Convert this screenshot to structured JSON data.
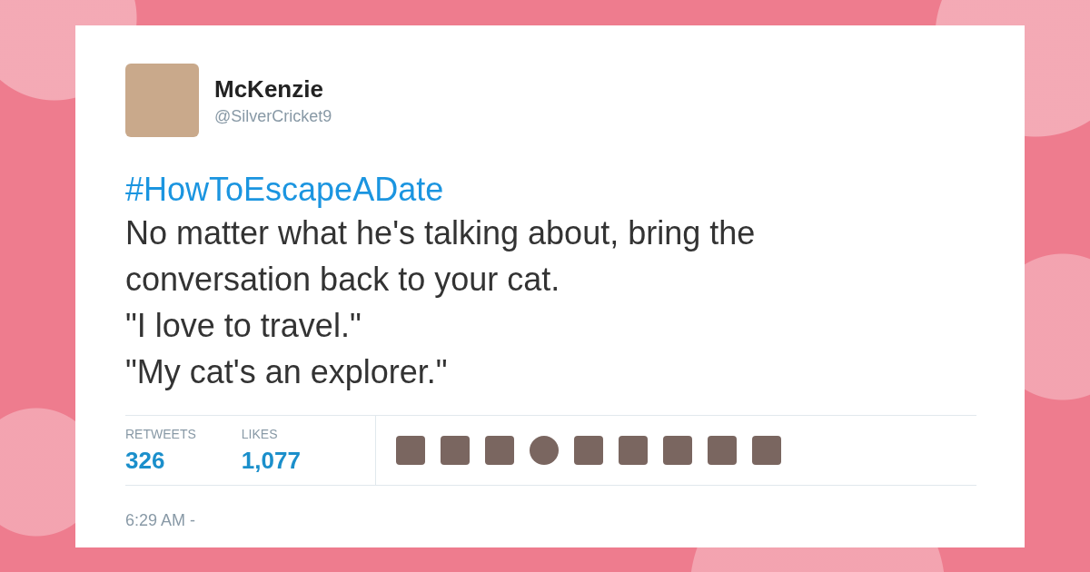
{
  "tweet": {
    "name": "McKenzie",
    "handle": "@SilverCricket9",
    "hashtag": "#HowToEscapeADate",
    "lines": [
      "No matter what he's talking about, bring the",
      "conversation back to your cat.",
      "\"I love to travel.\"",
      "\"My cat's an explorer.\""
    ],
    "stats": [
      {
        "label": "RETWEETS",
        "value": "326"
      },
      {
        "label": "LIKES",
        "value": "1,077"
      }
    ],
    "likers": [
      {
        "kind": "square"
      },
      {
        "kind": "square"
      },
      {
        "kind": "square"
      },
      {
        "kind": "circle"
      },
      {
        "kind": "square"
      },
      {
        "kind": "square"
      },
      {
        "kind": "square"
      },
      {
        "kind": "square"
      },
      {
        "kind": "square"
      }
    ],
    "time": "6:29 AM -"
  }
}
